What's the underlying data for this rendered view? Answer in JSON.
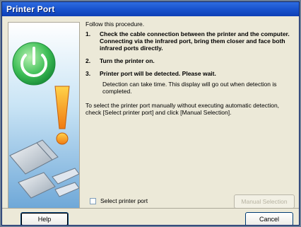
{
  "window": {
    "title": "Printer Port"
  },
  "content": {
    "intro": "Follow this procedure.",
    "steps": [
      {
        "num": "1.",
        "text": "Check the cable connection between the printer and the computer. Connecting via the infrared port, bring them closer and face both infrared ports directly."
      },
      {
        "num": "2.",
        "text": "Turn the printer on."
      },
      {
        "num": "3.",
        "text": "Printer port will be detected. Please wait."
      }
    ],
    "note": "Detection can take time. This display will go out when detection is completed.",
    "manual": "To select the printer port manually without executing automatic detection, check [Select printer port] and click [Manual Selection]."
  },
  "controls": {
    "select_port_label": "Select printer port",
    "select_port_checked": false,
    "manual_selection_label": "Manual Selection",
    "help_label": "Help",
    "cancel_label": "Cancel"
  },
  "colors": {
    "title_bar": "#1a55d0",
    "dialog_bg": "#ece9d8",
    "power_icon": "#2aa84a",
    "warning_icon": "#f08a1a"
  }
}
